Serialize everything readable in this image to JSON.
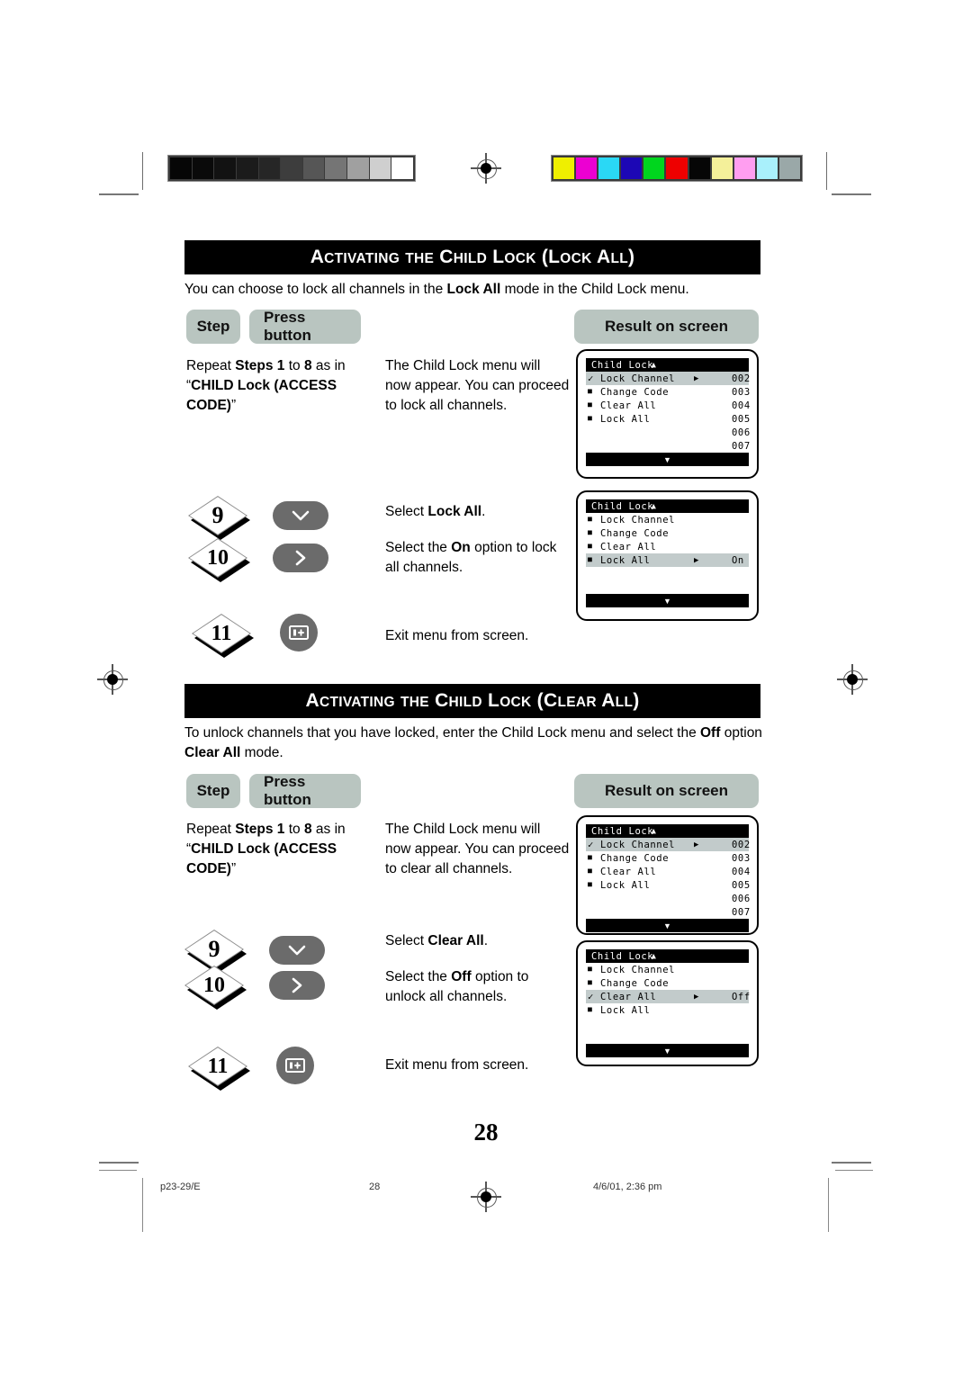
{
  "document": {
    "page_number": "28",
    "footer_left": "p23-29/E",
    "footer_center": "28",
    "footer_right": "4/6/01, 2:36 pm"
  },
  "calibration": {
    "grayscale_swatches": [
      "#060606",
      "#0a0a0a",
      "#121212",
      "#1b1b1b",
      "#262626",
      "#3d3d3d",
      "#565656",
      "#757575",
      "#a0a0a0",
      "#cfcfcf",
      "#ffffff"
    ],
    "color_swatches": [
      "#efef00",
      "#ec00d2",
      "#2ad8f5",
      "#1c07b5",
      "#00d61e",
      "#ee0000",
      "#060606",
      "#f4f09a",
      "#ff9ef0",
      "#a9f0fb",
      "#9aa8a8"
    ]
  },
  "sections": [
    {
      "id": "lock-all",
      "title": "Activating the Child Lock (Lock All)",
      "title_parts": [
        {
          "t": "A",
          "caps": true
        },
        {
          "t": "CTIVATING",
          "caps": false
        },
        {
          "t": " THE ",
          "caps": false
        },
        {
          "t": "C",
          "caps": true
        },
        {
          "t": "HILD",
          "caps": false
        },
        {
          "t": " L",
          "caps": true
        },
        {
          "t": "OCK",
          "caps": false
        },
        {
          "t": " (L",
          "caps": true
        },
        {
          "t": "OCK",
          "caps": false
        },
        {
          "t": " A",
          "caps": true
        },
        {
          "t": "LL)",
          "caps": false
        }
      ],
      "intro_html": "You can choose to lock all channels in the <b>Lock All</b> mode in the Child Lock menu.",
      "headers": {
        "step": "Step",
        "press_button": "Press button",
        "result": "Result on screen"
      },
      "rows": [
        {
          "step": "",
          "button": "none",
          "instruction_html": "Repeat <b>Steps 1</b> to <b>8</b> as in &ldquo;<span class='sc'>CHILD</span> <b>Lock (<span class='sc'>ACCESS</span> <span class='sc'>CODE</span>)</b>&rdquo;",
          "step_text_html": "Repeat <b>Steps 1</b> to <b>8</b> as in &ldquo;<b><span class='sc'>C</span>HILD <span class='sc'>L</span>ock (<span class='sc'>A</span>CCESS <span class='sc'>C</span>ODE)</b>&rdquo;",
          "result_html": "The Child Lock menu will now appear. You can proceed to lock all channels."
        },
        {
          "step": "9",
          "button": "down-arrow",
          "result_html": "Select <b>Lock All</b>."
        },
        {
          "step": "10",
          "button": "right-arrow",
          "result_html": "Select the <b>On</b> option to lock all channels."
        },
        {
          "step": "11",
          "button": "menu-exit",
          "result_html": "Exit menu from screen."
        }
      ],
      "screens": [
        {
          "title": "Child Lock",
          "up_arrow": "▲",
          "down_arrow": "▼",
          "items": [
            {
              "mark": "check",
              "label": "Lock Channel",
              "arrow": true,
              "value": "",
              "highlight": true
            },
            {
              "mark": "bullet",
              "label": "Change Code",
              "arrow": false,
              "value": "",
              "highlight": false
            },
            {
              "mark": "bullet",
              "label": "Clear All",
              "arrow": false,
              "value": "",
              "highlight": false
            },
            {
              "mark": "bullet",
              "label": "Lock All",
              "arrow": false,
              "value": "",
              "highlight": false
            }
          ],
          "numbers": [
            "002",
            "003",
            "004",
            "005",
            "006",
            "007"
          ]
        },
        {
          "title": "Child Lock",
          "up_arrow": "▲",
          "down_arrow": "▼",
          "items": [
            {
              "mark": "bullet",
              "label": "Lock Channel",
              "arrow": false,
              "value": "",
              "highlight": false
            },
            {
              "mark": "bullet",
              "label": "Change Code",
              "arrow": false,
              "value": "",
              "highlight": false
            },
            {
              "mark": "bullet",
              "label": "Clear All",
              "arrow": false,
              "value": "",
              "highlight": false
            },
            {
              "mark": "bullet",
              "label": "Lock All",
              "arrow": true,
              "value": "On",
              "highlight": true
            }
          ],
          "numbers": []
        }
      ]
    },
    {
      "id": "clear-all",
      "title": "Activating the Child Lock (Clear All)",
      "intro_html": "To unlock channels that you have locked, enter the Child Lock menu and select the <b>Off</b> option <b>Clear All</b> mode.",
      "headers": {
        "step": "Step",
        "press_button": "Press button",
        "result": "Result on screen"
      },
      "rows": [
        {
          "step": "",
          "button": "none",
          "step_text_html": "Repeat <b>Steps 1</b> to <b>8</b> as in &ldquo;<b><span class='sc'>C</span>HILD <span class='sc'>L</span>ock (<span class='sc'>A</span>CCESS <span class='sc'>C</span>ODE)</b>&rdquo;",
          "result_html": "The Child Lock menu will now appear. You can proceed to clear all channels."
        },
        {
          "step": "9",
          "button": "down-arrow",
          "result_html": "Select <b>Clear All</b>."
        },
        {
          "step": "10",
          "button": "right-arrow",
          "result_html": "Select the <b>Off</b> option to unlock all channels."
        },
        {
          "step": "11",
          "button": "menu-exit",
          "result_html": "Exit menu from screen."
        }
      ],
      "screens": [
        {
          "title": "Child Lock",
          "up_arrow": "▲",
          "down_arrow": "▼",
          "items": [
            {
              "mark": "check",
              "label": "Lock Channel",
              "arrow": true,
              "value": "",
              "highlight": true
            },
            {
              "mark": "bullet",
              "label": "Change Code",
              "arrow": false,
              "value": "",
              "highlight": false
            },
            {
              "mark": "bullet",
              "label": "Clear All",
              "arrow": false,
              "value": "",
              "highlight": false
            },
            {
              "mark": "bullet",
              "label": "Lock All",
              "arrow": false,
              "value": "",
              "highlight": false
            }
          ],
          "numbers": [
            "002",
            "003",
            "004",
            "005",
            "006",
            "007"
          ]
        },
        {
          "title": "Child Lock",
          "up_arrow": "▲",
          "down_arrow": "▼",
          "items": [
            {
              "mark": "bullet",
              "label": "Lock Channel",
              "arrow": false,
              "value": "",
              "highlight": false
            },
            {
              "mark": "bullet",
              "label": "Change Code",
              "arrow": false,
              "value": "",
              "highlight": false
            },
            {
              "mark": "check",
              "label": "Clear All",
              "arrow": true,
              "value": "Off",
              "highlight": true
            },
            {
              "mark": "bullet",
              "label": "Lock All",
              "arrow": false,
              "value": "",
              "highlight": false
            }
          ],
          "numbers": []
        }
      ]
    }
  ]
}
